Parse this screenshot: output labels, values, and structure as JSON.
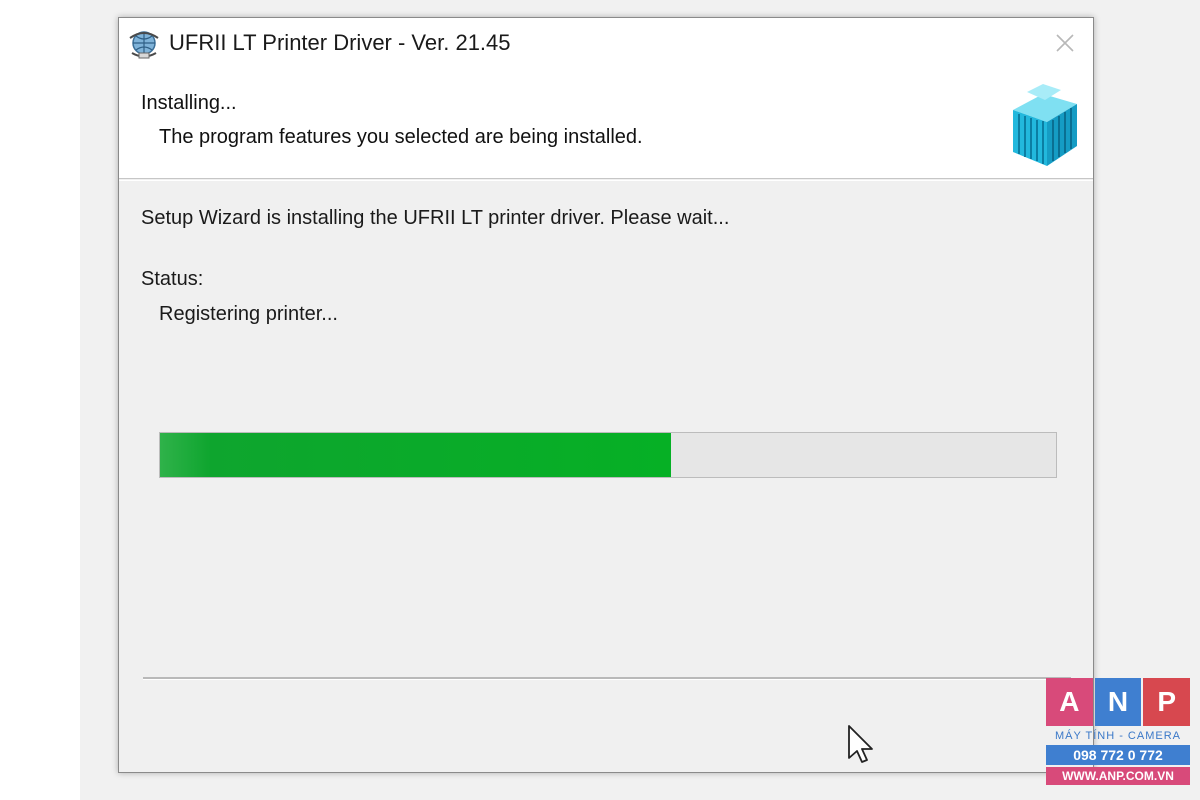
{
  "window": {
    "title": "UFRII LT Printer Driver - Ver. 21.45",
    "icon": "installer-globe-icon",
    "close_icon": "close-icon"
  },
  "header": {
    "title": "Installing...",
    "subtitle": "The program features you selected are being installed.",
    "graphic": "printer-driver-package-icon"
  },
  "body": {
    "message": "Setup Wizard is installing the UFRII LT printer driver. Please wait...",
    "status_label": "Status:",
    "status_value": "Registering printer...",
    "progress": 0.57,
    "progress_color": "#06b025"
  },
  "watermark": {
    "letters": [
      "A",
      "N",
      "P"
    ],
    "tagline": "MÁY TÍNH - CAMERA",
    "phone": "098 772 0 772",
    "website": "WWW.ANP.COM.VN"
  }
}
